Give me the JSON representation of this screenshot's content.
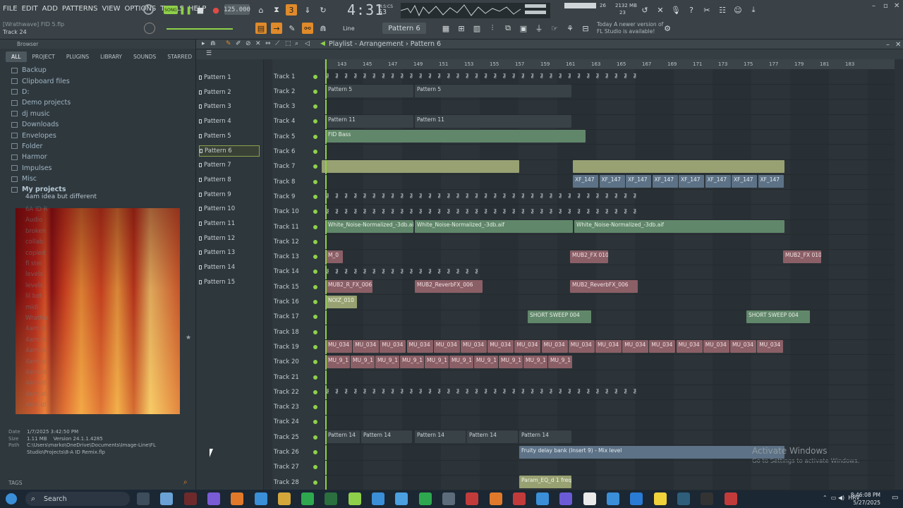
{
  "menu": [
    "FILE",
    "EDIT",
    "ADD",
    "PATTERNS",
    "VIEW",
    "OPTIONS",
    "TOOLS",
    "HELP"
  ],
  "hint": "[Wrathwave] FID 5.flp",
  "hint_track": "Track 24",
  "tempo": "125.000",
  "time": "4:31",
  "time_sub": "53",
  "time_label": "M:S:CS",
  "cpu": "26",
  "mem": "2132 MB",
  "mem2": "23",
  "snap": "Line",
  "pattern_selector": "Pattern 6",
  "news_line1": "Today  A newer version of",
  "news_line2": "FL Studio is available!",
  "browser": {
    "title": "Browser",
    "tabs": [
      "ALL",
      "PROJECT",
      "PLUGINS",
      "LIBRARY",
      "SOUNDS",
      "STARRED"
    ],
    "folders": [
      "Backup",
      "Clipboard files",
      "D:",
      "Demo projects",
      "dj music",
      "Downloads",
      "Envelopes",
      "Folder",
      "Harmor",
      "Impulses",
      "Misc",
      "My projects"
    ],
    "subitem": "4am idea but different",
    "ghost_items": [
      "6A ID R",
      "Audio",
      "broken",
      "collab",
      "copied",
      "fl stei",
      "levels",
      "levels",
      "lil bot",
      "midi",
      "Wrathw",
      "4am id",
      "4am id",
      "4am id",
      "4am id",
      "4am id",
      "4am id",
      "4am id",
      "4am id"
    ],
    "meta": {
      "date_k": "Date",
      "date": "1/7/2025 3:42:50 PM",
      "size_k": "Size",
      "size": "1.11 MB",
      "version": "Version 24.1.1.4285",
      "path_k": "Path",
      "path": "C:\\Users\\marko\\OneDrive\\Documents\\Image-Line\\FL Studio\\Projects\\8-A ID Remix.flp"
    },
    "tags": "TAGS"
  },
  "playlist": {
    "title": "Playlist - Arrangement",
    "pattern": "Pattern 6",
    "ruler": [
      "143",
      "145",
      "147",
      "149",
      "151",
      "153",
      "155",
      "157",
      "159",
      "161",
      "163",
      "165",
      "167",
      "169",
      "171",
      "173",
      "175",
      "177",
      "179",
      "181",
      "183"
    ],
    "patterns": [
      "Pattern 1",
      "Pattern 2",
      "Pattern 3",
      "Pattern 4",
      "Pattern 5",
      "Pattern 6",
      "Pattern 7",
      "Pattern 8",
      "Pattern 9",
      "Pattern 10",
      "Pattern 11",
      "Pattern 12",
      "Pattern 13",
      "Pattern 14",
      "Pattern 15"
    ],
    "tracks": [
      "Track 1",
      "Track 2",
      "Track 3",
      "Track 4",
      "Track 5",
      "Track 6",
      "Track 7",
      "Track 8",
      "Track 9",
      "Track 10",
      "Track 11",
      "Track 12",
      "Track 13",
      "Track 14",
      "Track 15",
      "Track 16",
      "Track 17",
      "Track 18",
      "Track 19",
      "Track 20",
      "Track 21",
      "Track 22",
      "Track 23",
      "Track 24",
      "Track 25",
      "Track 26",
      "Track 27",
      "Track 28"
    ],
    "clips": {
      "p5a": "Pattern 5",
      "p5b": "Pattern 5",
      "p11a": "Pattern 11",
      "p11b": "Pattern 11",
      "fid": "FID Bass",
      "xf": "XF_147",
      "wn1": "White_Noise-Normalized_-3db.aif",
      "wn2": "White_Noise-Normalized_-3db.aif",
      "wn3": "White_Noise-Normalized_-3db.aif",
      "m0": "M_0",
      "fx010a": "MUB2_FX 010",
      "fx010b": "MUB2_FX 010",
      "rfx1": "MUB2_R_FX_006",
      "rfx2": "MUB2_ReverbFX_006",
      "rfx3": "MUB2_ReverbFX_006",
      "noiz": "NOIZ_010",
      "sw1": "SHORT SWEEP 004",
      "sw2": "SHORT SWEEP 004",
      "mu034": "MU_034",
      "mu9": "MU_9_1",
      "p14": "Pattern 14",
      "delay": "Fruity delay bank (Insert 9) - Mix level",
      "param": "Param_EQ_d 1 freq"
    }
  },
  "watermark": "Activate Windows",
  "watermark2": "Go to Settings to activate Windows.",
  "taskbar": {
    "search": "Search",
    "lang": "HRV",
    "time": "8:46:08 PM",
    "date": "5/27/2025"
  }
}
